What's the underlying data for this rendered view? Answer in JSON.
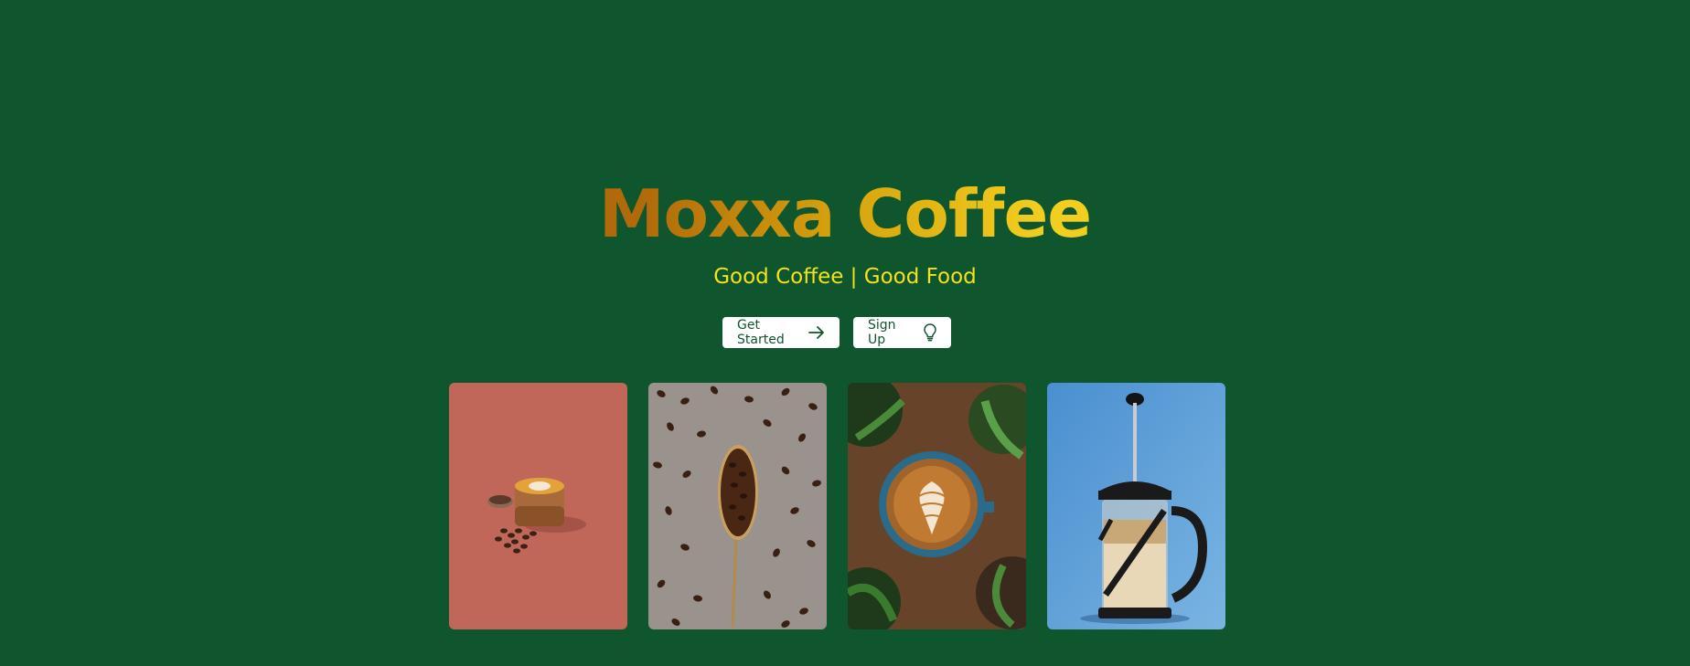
{
  "hero": {
    "title": "Moxxa Coffee",
    "tagline": "Good Coffee | Good Food"
  },
  "buttons": {
    "get_started": {
      "label": "Get Started",
      "icon": "arrow-right-icon"
    },
    "sign_up": {
      "label": "Sign Up",
      "icon": "lightbulb-icon"
    }
  },
  "gallery": [
    {
      "name": "latte-glass-photo",
      "background": "#c0675a"
    },
    {
      "name": "coffee-beans-spoon-photo",
      "background": "#9a928d"
    },
    {
      "name": "latte-art-plants-photo",
      "background": "#4a3a2a"
    },
    {
      "name": "french-press-photo",
      "background": "#5a9bd5"
    }
  ],
  "colors": {
    "page_background": "#0f552d",
    "title_gradient_start": "#b06a0a",
    "title_gradient_end": "#f2cf1f",
    "tagline": "#f5e21f",
    "button_background": "#ffffff",
    "button_text": "#0f552d"
  }
}
